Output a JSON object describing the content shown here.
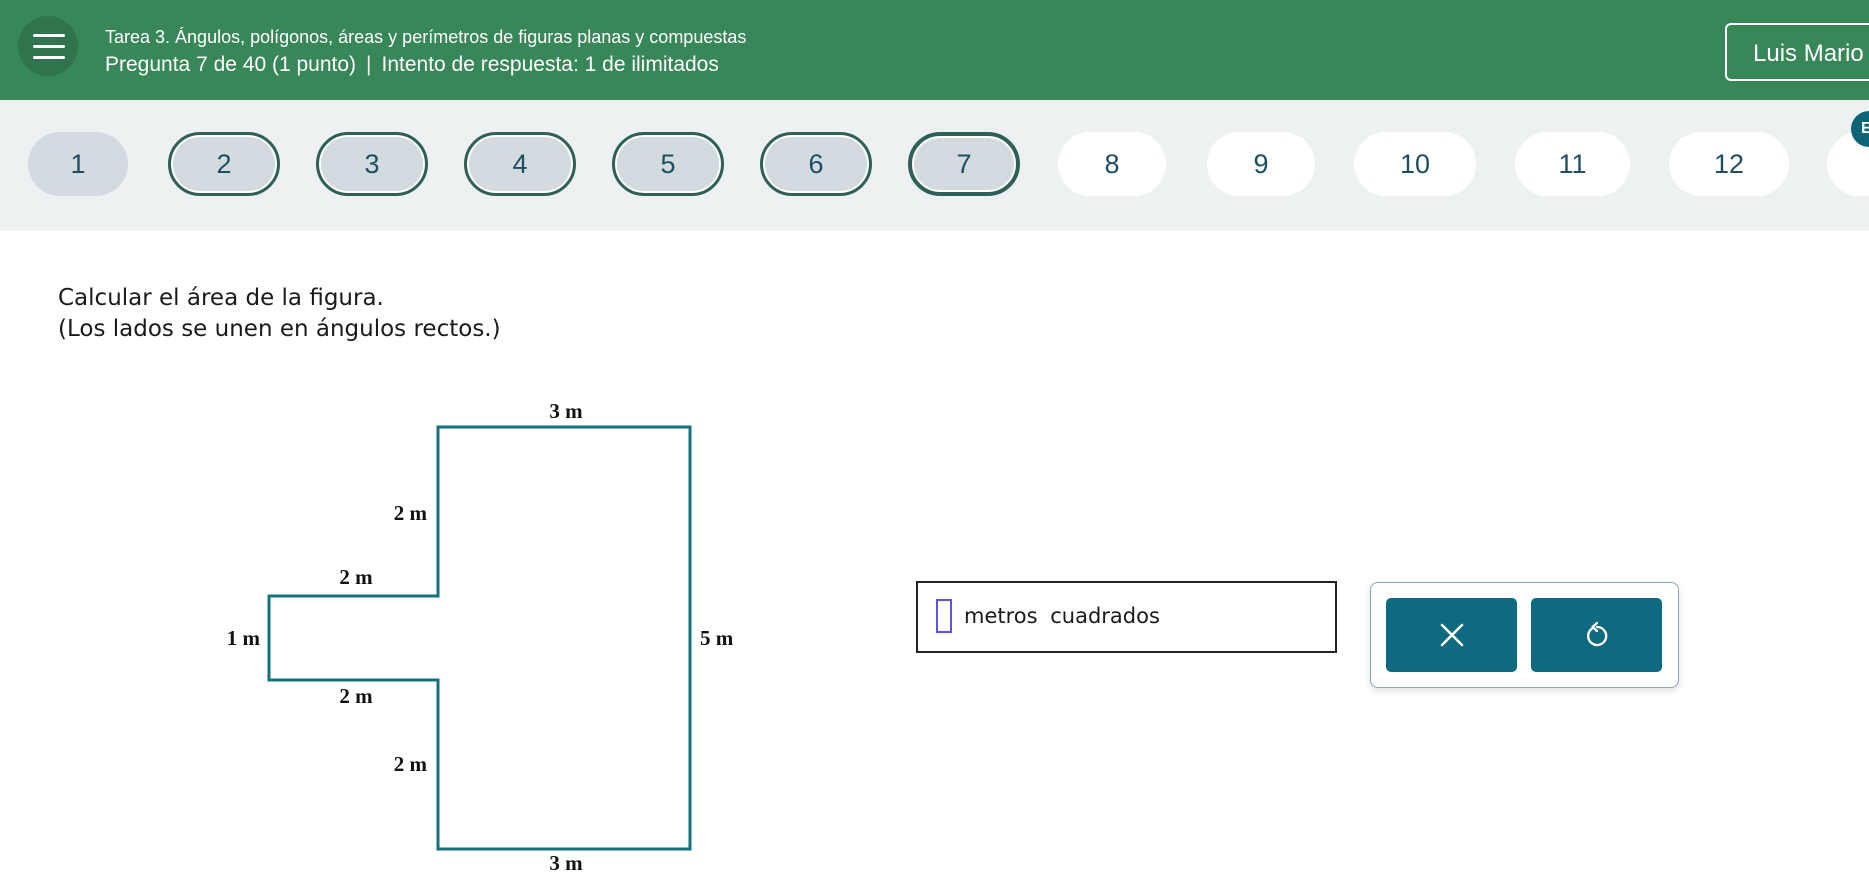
{
  "header": {
    "assignment_title": "Tarea 3. Ángulos, polígonos, áreas y perímetros de figuras planas y compuestas",
    "question_info": "Pregunta 7 de 40 (1 punto)",
    "separator": "|",
    "attempt_info": "Intento de respuesta: 1 de ilimitados",
    "user_name": "Luis Mario",
    "colors": {
      "bar": "#378759",
      "text": "#ffffff"
    }
  },
  "navigation": {
    "questions": [
      {
        "label": "1",
        "state": "visited"
      },
      {
        "label": "2",
        "state": "answered"
      },
      {
        "label": "3",
        "state": "answered"
      },
      {
        "label": "4",
        "state": "answered"
      },
      {
        "label": "5",
        "state": "answered"
      },
      {
        "label": "6",
        "state": "answered"
      },
      {
        "label": "7",
        "state": "current"
      },
      {
        "label": "8",
        "state": "open"
      },
      {
        "label": "9",
        "state": "open"
      },
      {
        "label": "10",
        "state": "open"
      },
      {
        "label": "11",
        "state": "open"
      },
      {
        "label": "12",
        "state": "open"
      },
      {
        "label": "",
        "state": "open"
      }
    ],
    "badge": "E"
  },
  "question": {
    "line1": "Calcular el área de la figura.",
    "line2": "(Los lados se unen en ángulos rectos.)"
  },
  "figure": {
    "stroke_color": "#17707e",
    "labels": {
      "top": "3 m",
      "upper_left_vertical": "2 m",
      "upper_notch_horizontal": "2 m",
      "left_side": "1 m",
      "lower_notch_horizontal": "2 m",
      "lower_left_vertical": "2 m",
      "right_side": "5 m",
      "bottom": "3 m"
    }
  },
  "answer": {
    "value": "",
    "unit": "metros cuadrados"
  },
  "tools": {
    "clear_icon": "close-icon",
    "reset_icon": "undo-icon",
    "color": "#0e6a7e"
  }
}
